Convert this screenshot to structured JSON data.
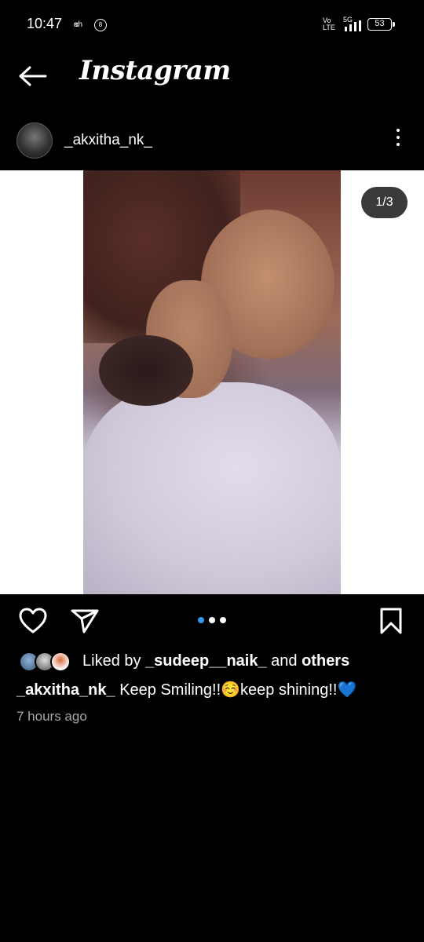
{
  "status_bar": {
    "time": "10:47",
    "indicators": [
      "ഭh",
      "volte-icon",
      "5G",
      "signal-icon"
    ],
    "battery": "53"
  },
  "header": {
    "title": "Instagram"
  },
  "post": {
    "username": "_akxitha_nk_",
    "image_counter": "1/3",
    "carousel": {
      "total": 3,
      "active_index": 0,
      "active_color": "#3797f0",
      "inactive_color": "#ffffff"
    },
    "likes": {
      "prefix": "Liked by",
      "user": "_sudeep__naik_",
      "connector": "and",
      "others": "others"
    },
    "caption": {
      "username": "_akxitha_nk_",
      "text": "Keep Smiling!!☺️keep shining!!💙"
    },
    "time_ago": "7 hours ago"
  }
}
